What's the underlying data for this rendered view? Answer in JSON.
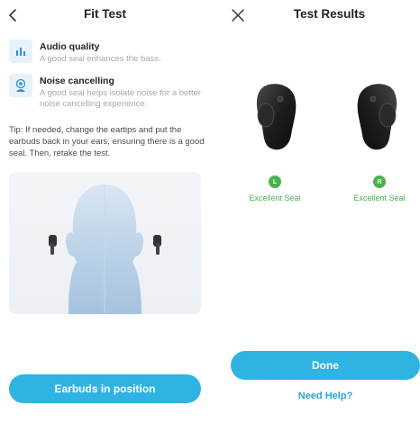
{
  "fit_test": {
    "title": "Fit Test",
    "features": [
      {
        "icon": "bars-chart-icon",
        "title": "Audio quality",
        "desc": "A good seal enhances the bass."
      },
      {
        "icon": "listener-icon",
        "title": "Noise cancelling",
        "desc": "A good seal helps isolate noise for a better noise cancelling experience."
      }
    ],
    "tip": "Tip: If needed, change the eartips and put the earbuds back in your ears, ensuring there is a good seal. Then, retake the test.",
    "button_label": "Earbuds in position"
  },
  "test_results": {
    "title": "Test Results",
    "left": {
      "badge": "L",
      "status": "Excellent Seal"
    },
    "right": {
      "badge": "R",
      "status": "Excellent Seal"
    },
    "done_label": "Done",
    "help_label": "Need Help?"
  },
  "colors": {
    "accent": "#2fb3e3",
    "success": "#46b34c",
    "link": "#2aa3d6"
  }
}
